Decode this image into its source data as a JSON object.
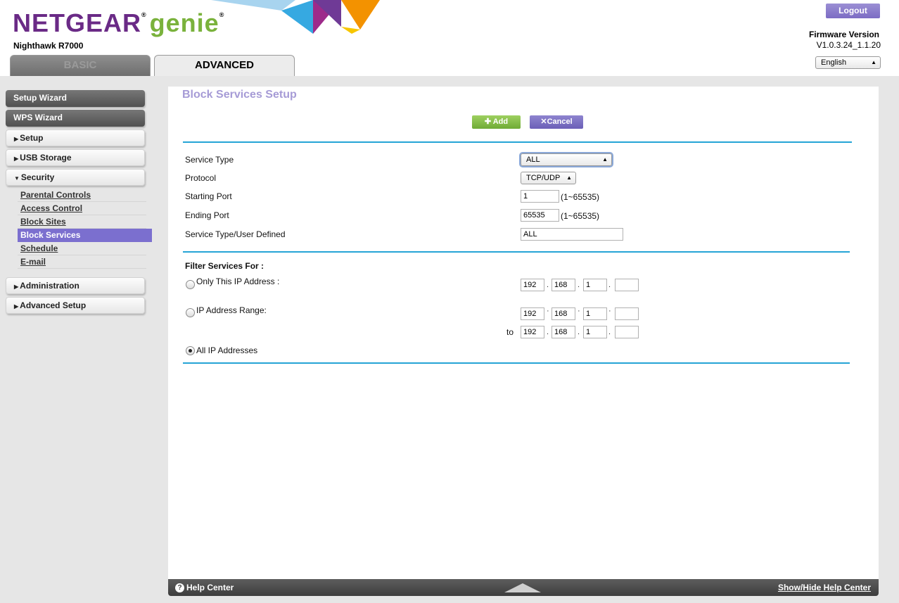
{
  "header": {
    "brand": "NETGEAR",
    "genie": "genie",
    "model": "Nighthawk R7000",
    "logout_label": "Logout",
    "firmware_label": "Firmware Version",
    "firmware_value": "V1.0.3.24_1.1.20",
    "language": "English"
  },
  "tabs": {
    "basic": "BASIC",
    "advanced": "ADVANCED"
  },
  "sidebar": {
    "setup_wizard": "Setup Wizard",
    "wps_wizard": "WPS Wizard",
    "setup": "Setup",
    "usb_storage": "USB Storage",
    "security": "Security",
    "security_items": [
      "Parental Controls",
      "Access Control",
      "Block Sites",
      "Block Services",
      "Schedule",
      "E-mail"
    ],
    "administration": "Administration",
    "advanced_setup": "Advanced Setup"
  },
  "main": {
    "title": "Block Services Setup",
    "add_label": "Add",
    "cancel_label": "Cancel",
    "service_type_label": "Service Type",
    "service_type_value": "ALL",
    "protocol_label": "Protocol",
    "protocol_value": "TCP/UDP",
    "starting_port_label": "Starting Port",
    "starting_port_value": "1",
    "ending_port_label": "Ending Port",
    "ending_port_value": "65535",
    "port_range_hint": "(1~65535)",
    "user_defined_label": "Service Type/User Defined",
    "user_defined_value": "ALL",
    "filter_label": "Filter Services For :",
    "only_ip_label": "Only This IP Address :",
    "ip_range_label": "IP Address Range:",
    "to_label": "to",
    "all_ip_label": "All IP Addresses",
    "only_ip": [
      "192",
      "168",
      "1",
      ""
    ],
    "range_start": [
      "192",
      "168",
      "1",
      ""
    ],
    "range_end": [
      "192",
      "168",
      "1",
      ""
    ],
    "selected_filter": "All IP Addresses"
  },
  "footer": {
    "help_center": "Help Center",
    "show_hide": "Show/Hide Help Center"
  },
  "colors": {
    "brand_purple": "#6a2a86",
    "genie_green": "#7ab23c",
    "accent_blue": "#25a4d6",
    "active_purple": "#7b6fcf"
  }
}
